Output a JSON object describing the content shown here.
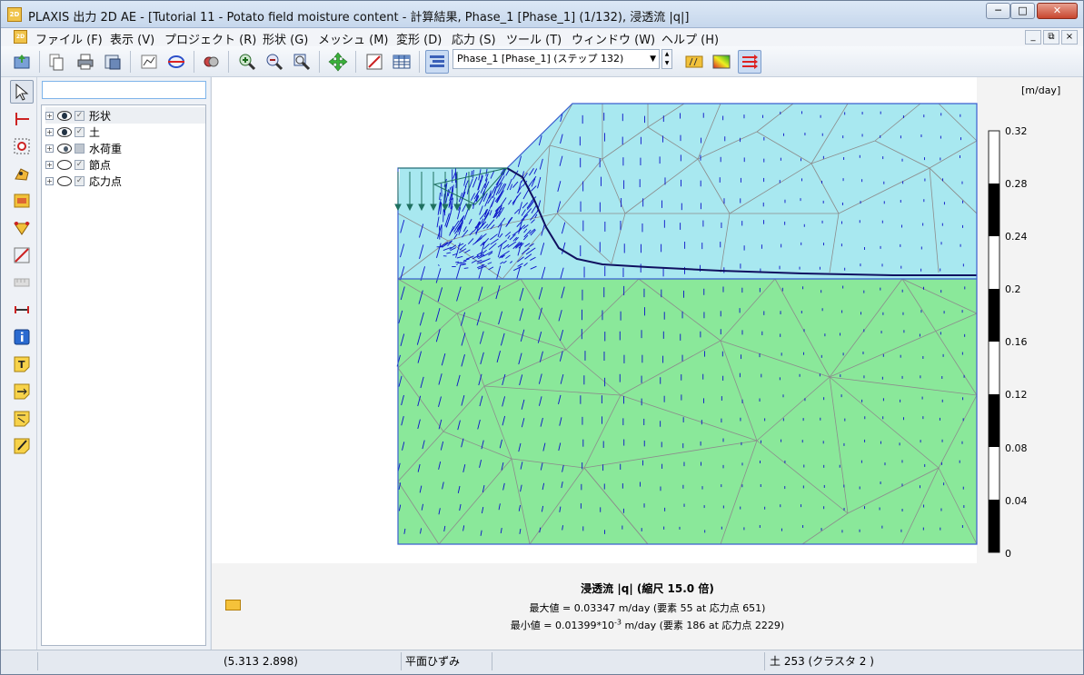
{
  "window": {
    "app_icon": "2D",
    "title": "PLAXIS 出力 2D AE - [Tutorial 11 - Potato field moisture content - 計算結果, Phase_1 [Phase_1] (1/132), 浸透流 |q|]",
    "minimize": "─",
    "maximize": "□",
    "close": "✕"
  },
  "menu": {
    "items": [
      "ファイル (F)",
      "表示 (V)",
      "プロジェクト (R)",
      "形状 (G)",
      "メッシュ (M)",
      "変形 (D)",
      "応力 (S)",
      "ツール (T)",
      "ウィンドウ (W)",
      "ヘルプ (H)"
    ],
    "mdi_minimize": "_",
    "mdi_restore": "⧉",
    "mdi_close": "×"
  },
  "toolbar": {
    "phase_selected": "Phase_1 [Phase_1] (ステップ 132)",
    "icons": [
      "open-project-icon",
      "copy-icon",
      "print-icon",
      "export-icon",
      "chart-icon",
      "cross-section-icon",
      "view-icon",
      "zoom-in-icon",
      "zoom-out-icon",
      "zoom-window-icon",
      "pan-icon",
      "scale-icon",
      "table-icon",
      "show-plot-icon",
      "arrows-icon",
      "shadings-icon",
      "vectors-icon"
    ]
  },
  "explorer": {
    "search_value": "",
    "tree": [
      {
        "label": "形状",
        "eye": true,
        "checked": true,
        "selected": true
      },
      {
        "label": "土",
        "eye": true,
        "checked": true,
        "selected": false
      },
      {
        "label": "水荷重",
        "eye": true,
        "checked": false,
        "selected": false
      },
      {
        "label": "節点",
        "eye": false,
        "checked": true,
        "selected": false
      },
      {
        "label": "応力点",
        "eye": false,
        "checked": true,
        "selected": false
      }
    ]
  },
  "plot": {
    "unit": "[m/day]",
    "legend_values": [
      "0.32",
      "0.28",
      "0.24",
      "0.2",
      "0.16",
      "0.12",
      "0.08",
      "0.04",
      "0"
    ],
    "colors": {
      "upper_soil": "#a8e8f0",
      "lower_soil": "#8ae89a",
      "mesh": "#8c8c8c",
      "arrows": "#0a12c8",
      "boundary": "#3a5fd0",
      "phreatic": "#101060",
      "water_load": "#1f7060"
    },
    "result_title": "浸透流 |q| (縮尺 15.0 倍)",
    "max_line": "最大値 = 0.03347 m/day (要素 55 at 応力点 651)",
    "min_prefix": "最小値 = 0.01399*10",
    "min_exp": "-3",
    "min_suffix": " m/day (要素 186 at 応力点 2229)"
  },
  "status": {
    "coords": "(5.313 2.898)",
    "mode": "平面ひずみ",
    "info": "土 253 (クラスタ 2 )"
  }
}
